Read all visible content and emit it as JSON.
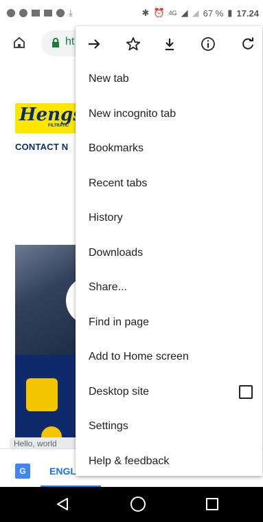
{
  "status_bar": {
    "network": "4G",
    "battery": "67 %",
    "time": "17.24"
  },
  "browser": {
    "url_partial": "ht"
  },
  "page": {
    "logo_text": "Hengs",
    "logo_sub": "FILTRATIC",
    "nav_text": "CONTACT  N",
    "chat_bubble": "Hello, world"
  },
  "translate_bar": {
    "language": "ENGL"
  },
  "menu": {
    "items": [
      {
        "label": "New tab"
      },
      {
        "label": "New incognito tab"
      },
      {
        "label": "Bookmarks"
      },
      {
        "label": "Recent tabs"
      },
      {
        "label": "History"
      },
      {
        "label": "Downloads"
      },
      {
        "label": "Share..."
      },
      {
        "label": "Find in page"
      },
      {
        "label": "Add to Home screen"
      },
      {
        "label": "Desktop site"
      },
      {
        "label": "Settings"
      },
      {
        "label": "Help & feedback"
      }
    ],
    "desktop_site_checked": false
  }
}
